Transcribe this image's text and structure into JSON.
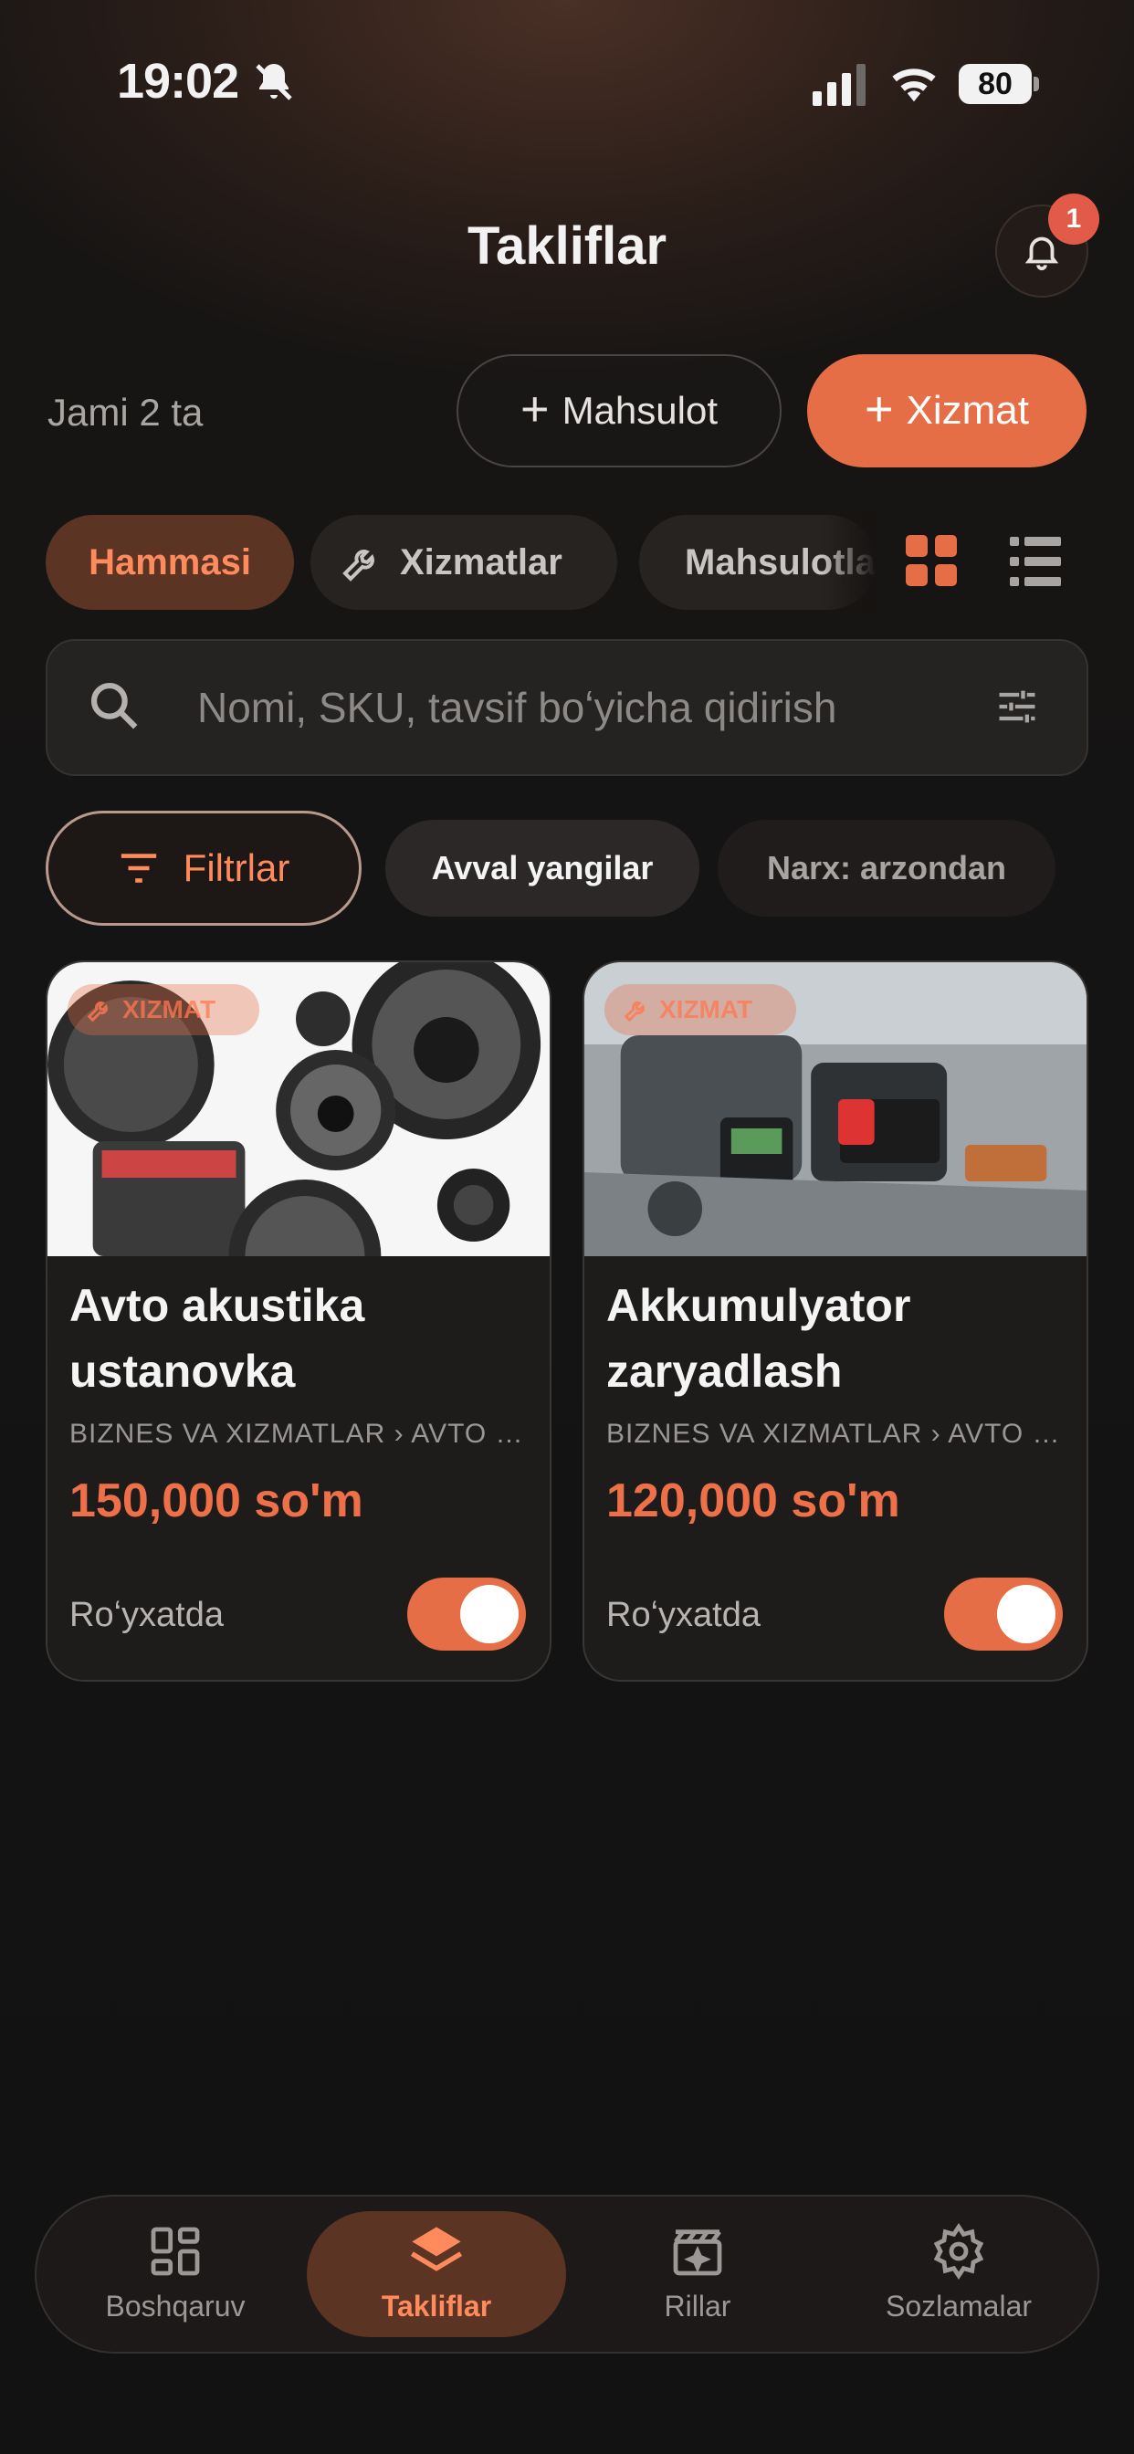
{
  "status_bar": {
    "time": "19:02",
    "battery": "80"
  },
  "header": {
    "title": "Takliflar",
    "notification_count": "1"
  },
  "summary": {
    "total": "Jami 2 ta"
  },
  "actions": {
    "add_product": "Mahsulot",
    "add_service": "Xizmat"
  },
  "tabs": [
    {
      "label": "Hammasi",
      "active": true
    },
    {
      "label": "Xizmatlar",
      "icon": "wrench-icon"
    },
    {
      "label": "Mahsulotlar",
      "icon": "archive-icon"
    }
  ],
  "view_toggle": {
    "active": "grid"
  },
  "search": {
    "placeholder": "Nomi, SKU, tavsif boʻyicha qidirish"
  },
  "filters": {
    "filter_label": "Filtrlar",
    "sort_options": [
      {
        "label": "Avval yangilar",
        "active": true
      },
      {
        "label": "Narx: arzondan",
        "active": false
      }
    ]
  },
  "offers": [
    {
      "tag": "XIZMAT",
      "title": "Avto akustika ustanovka",
      "category": "BIZNES VA XIZMATLAR › AVTO XIZMATLAR",
      "price": "150,000 so'm",
      "status": "Roʻyxatda",
      "listed": true
    },
    {
      "tag": "XIZMAT",
      "title": "Akkumulyator zaryadlash",
      "category": "BIZNES VA XIZMATLAR › AVTO XIZMATLAR",
      "price": "120,000 so'm",
      "status": "Roʻyxatda",
      "listed": true
    }
  ],
  "bottom_nav": [
    {
      "label": "Boshqaruv",
      "icon": "dashboard-icon"
    },
    {
      "label": "Takliflar",
      "icon": "layers-icon",
      "active": true
    },
    {
      "label": "Rillar",
      "icon": "clapperboard-icon"
    },
    {
      "label": "Sozlamalar",
      "icon": "gear-icon"
    }
  ],
  "colors": {
    "accent": "#e66e46",
    "accent_soft": "#5b3424",
    "badge": "#e25b48"
  }
}
